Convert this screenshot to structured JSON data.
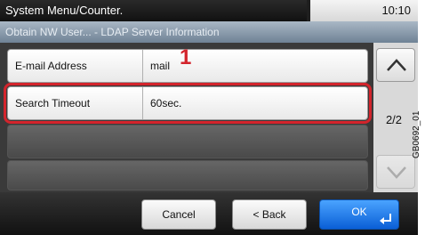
{
  "header": {
    "title": "System Menu/Counter.",
    "time": "10:10"
  },
  "breadcrumb": "Obtain NW User... - LDAP Server Information",
  "rows": [
    {
      "label": "E-mail Address",
      "value": "mail"
    },
    {
      "label": "Search Timeout",
      "value": "60sec."
    }
  ],
  "callout_number": "1",
  "pagination": {
    "indicator": "2/2"
  },
  "footer": {
    "cancel_label": "Cancel",
    "back_label": "< Back",
    "ok_label": "OK"
  },
  "figure_code": "GB0692_01",
  "colors": {
    "highlight": "#d3242c",
    "ok_button": "#0a5fd6"
  }
}
